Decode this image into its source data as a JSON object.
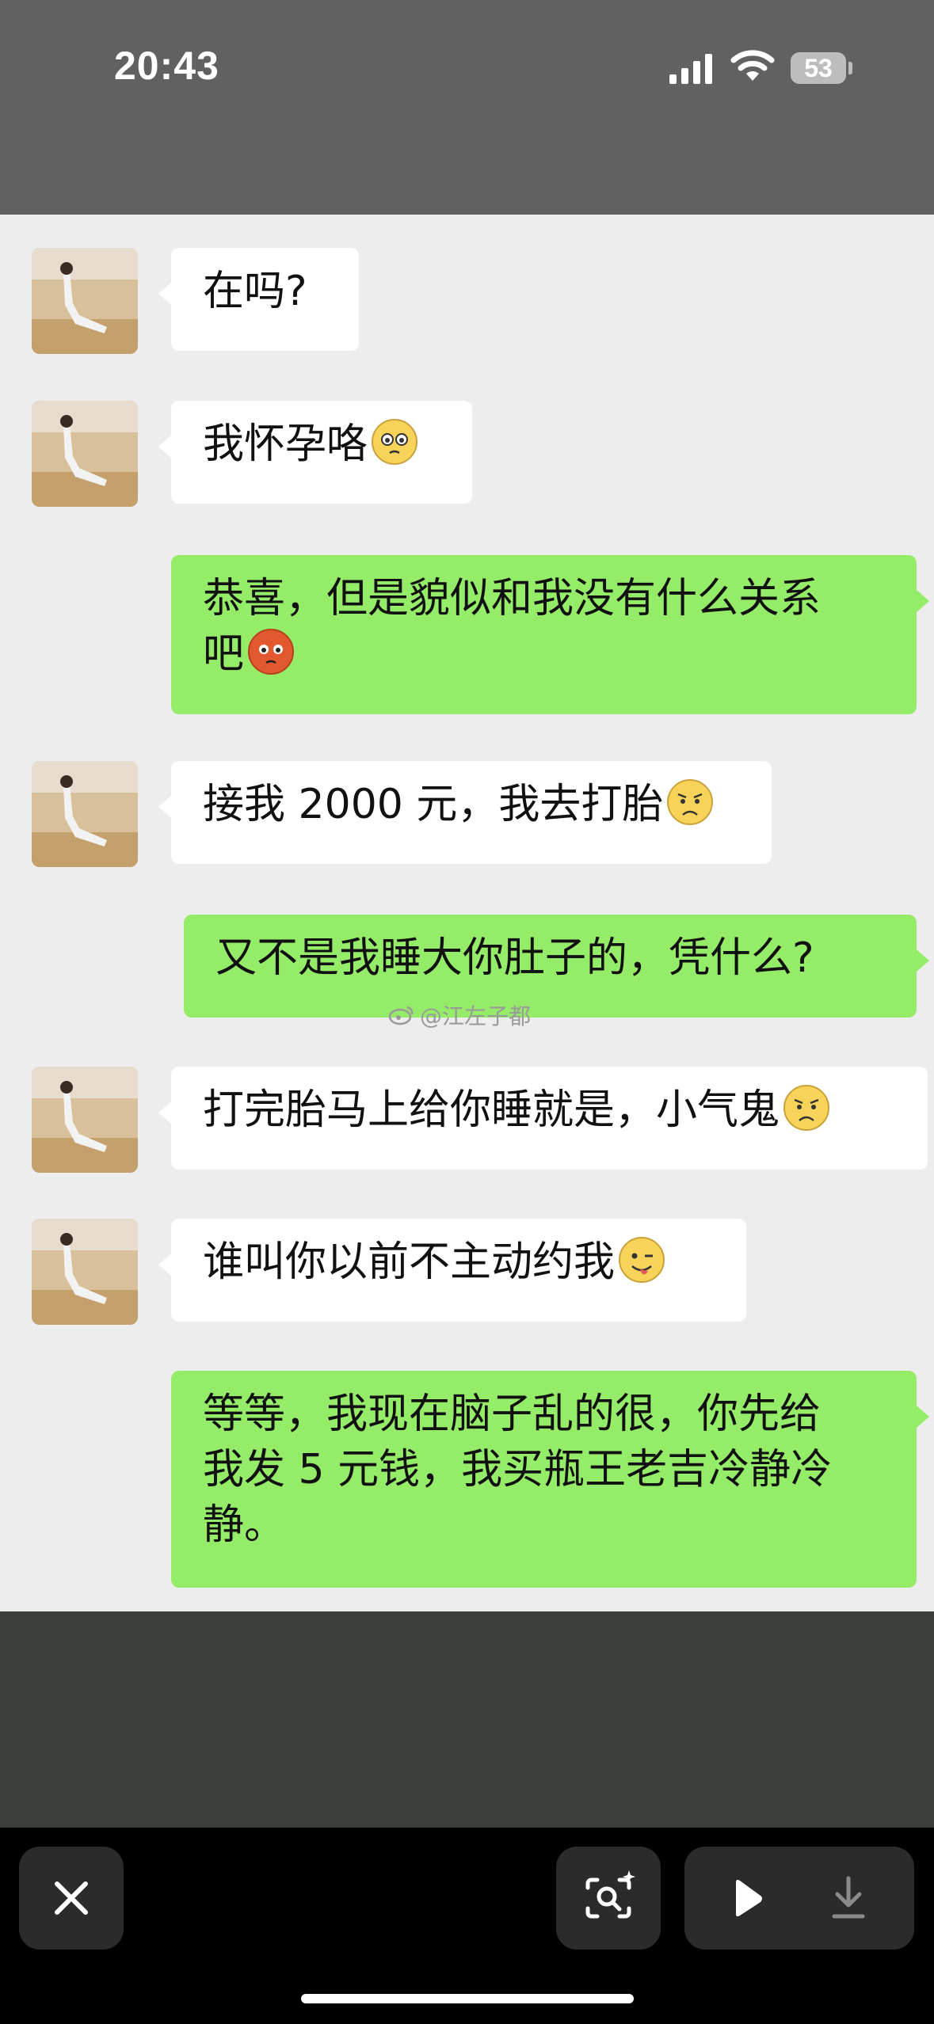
{
  "status_bar": {
    "time": "20:43",
    "battery": "53",
    "icons": [
      "signal-icon",
      "wifi-icon",
      "battery-icon"
    ]
  },
  "chat": {
    "messages": [
      {
        "side": "in",
        "text": "在吗?",
        "emoji": ""
      },
      {
        "side": "in",
        "text": "我怀孕咯",
        "emoji": "pleading-face-icon"
      },
      {
        "side": "out",
        "lines": [
          "恭喜，但是貌似和我没有什么关系",
          "吧"
        ],
        "emoji": "pouting-face-icon"
      },
      {
        "side": "in",
        "text": "接我 2000 元，我去打胎",
        "emoji": "frowning-face-icon"
      },
      {
        "side": "out",
        "text": "又不是我睡大你肚子的，凭什么?",
        "emoji": ""
      },
      {
        "side": "in",
        "text": "打完胎马上给你睡就是，小气鬼",
        "emoji": "frowning-face-icon"
      },
      {
        "side": "in",
        "text": "谁叫你以前不主动约我",
        "emoji": "winking-tongue-face-icon"
      },
      {
        "side": "out",
        "lines": [
          "等等，我现在脑子乱的很，你先给",
          "我发 5 元钱，我买瓶王老吉冷静冷",
          "静。"
        ],
        "emoji": ""
      }
    ],
    "watermark": "@江左子都"
  },
  "toolbar": {
    "buttons": [
      "close-icon",
      "visual-search-icon",
      "play-icon",
      "download-icon"
    ]
  },
  "colors": {
    "incoming_bubble": "#ffffff",
    "outgoing_bubble": "#95ec69",
    "chat_background": "#ededed",
    "status_background": "#616161"
  }
}
